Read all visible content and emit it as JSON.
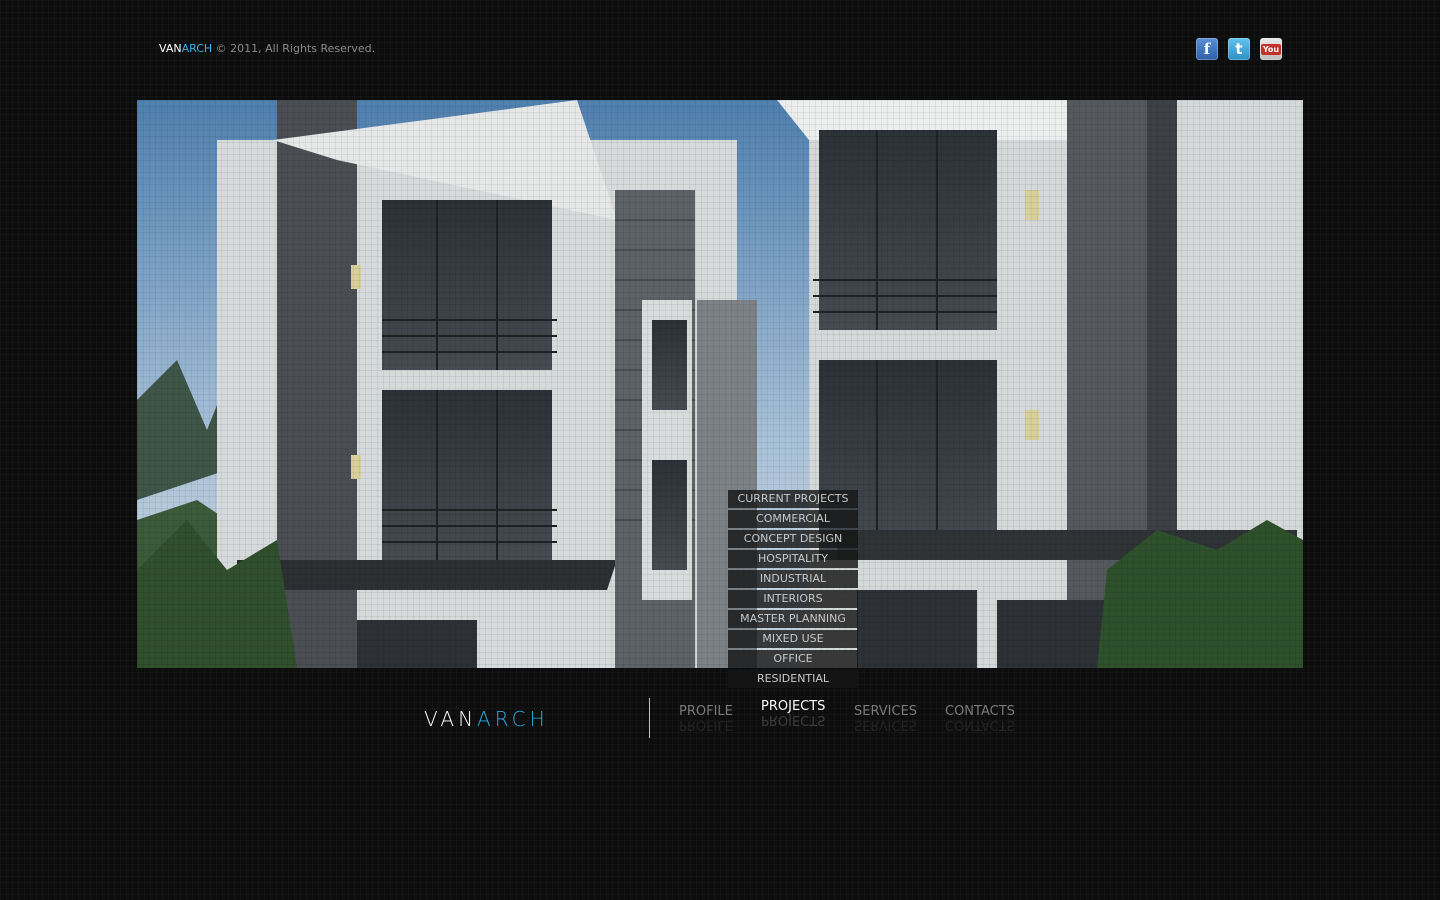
{
  "header": {
    "brand_van": "VAN",
    "brand_arch": "ARCH",
    "copyright": " © 2011, All Rights Reserved."
  },
  "social": [
    {
      "name": "facebook-icon",
      "glyph": "f"
    },
    {
      "name": "twitter-icon",
      "glyph": "t"
    },
    {
      "name": "youtube-icon",
      "glyph": "You"
    }
  ],
  "submenu": [
    "CURRENT PROJECTS",
    "COMMERCIAL",
    "CONCEPT DESIGN",
    "HOSPITALITY",
    "INDUSTRIAL",
    "INTERIORS",
    "MASTER PLANNING",
    "MIXED USE",
    "OFFICE",
    "RESIDENTIAL"
  ],
  "logo": {
    "part1": "VAN",
    "part2": "ARCH"
  },
  "nav": {
    "profile": "PROFILE",
    "projects": "PROJECTS",
    "services": "SERVICES",
    "contacts": "CONTACTS"
  },
  "colors": {
    "accent": "#27a9e1",
    "background": "#0d0d0d"
  }
}
